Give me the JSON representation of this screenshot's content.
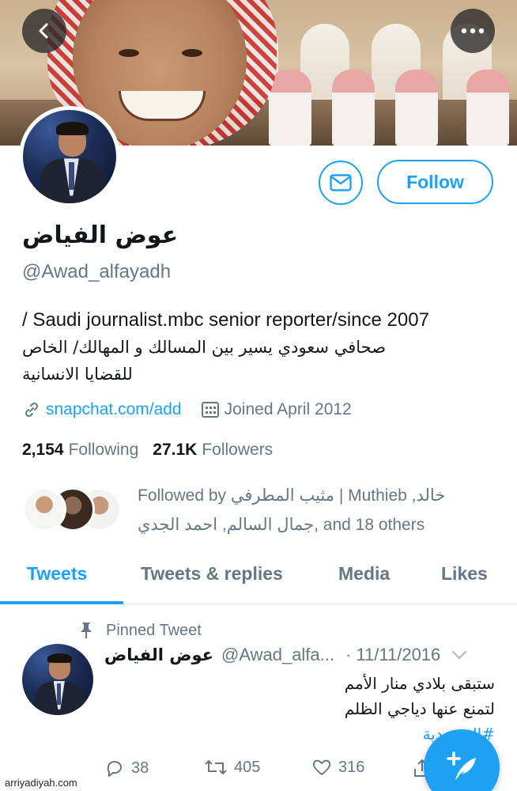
{
  "header": {
    "back_icon": "chevron-left-icon",
    "more_icon": "more-horizontal-icon"
  },
  "profile": {
    "display_name": "عوض الفياض",
    "handle": "@Awad_alfayadh",
    "follow_label": "Follow",
    "message_icon": "envelope-icon",
    "bio_line1": "/ Saudi journalist.mbc senior reporter/since 2007",
    "bio_line2": "صحافي سعودي يسير بين المسالك و المهالك/ الخاص",
    "bio_line3": "للقضايا الانسانية",
    "link": "snapchat.com/add",
    "joined": "Joined April 2012",
    "following_count": "2,154",
    "following_label": "Following",
    "followers_count": "27.1K",
    "followers_label": "Followers",
    "followed_by_line1": "Followed by مثيب المطرفي | Muthieb ,خالد",
    "followed_by_line2": "جمال السالم, احمد الجدي, and 18 others"
  },
  "tabs": [
    {
      "label": "Tweets",
      "active": true
    },
    {
      "label": "Tweets & replies",
      "active": false
    },
    {
      "label": "Media",
      "active": false
    },
    {
      "label": "Likes",
      "active": false
    }
  ],
  "tweet": {
    "pinned_label": "Pinned Tweet",
    "author_name": "عوض الفياض",
    "author_handle": "@Awad_alfa...",
    "date": "· 11/11/2016",
    "line1": "ستبقى بلادي منار الأمم",
    "line2": "لتمنع عنها دياجي الظلم",
    "hashtag": "#السعودية",
    "replies": "38",
    "retweets": "405",
    "likes": "316"
  },
  "compose_icon": "compose-tweet-icon",
  "watermark": "arriyadiyah.com",
  "colors": {
    "accent": "#1da1f2",
    "secondary_text": "#657786",
    "primary_text": "#14171a"
  }
}
